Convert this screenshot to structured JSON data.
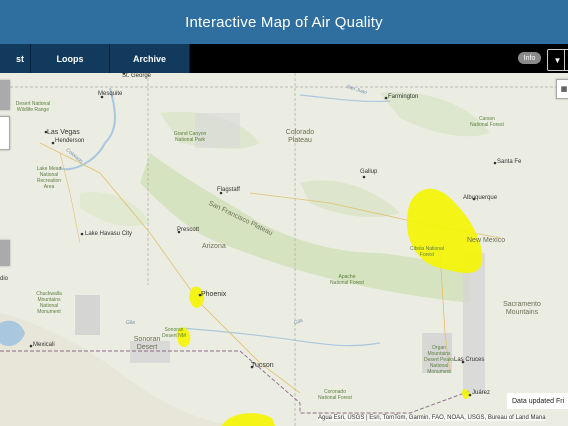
{
  "header": {
    "title": "Interactive Map of Air Quality"
  },
  "nav": {
    "tabs": [
      {
        "label": "st"
      },
      {
        "label": "Loops"
      },
      {
        "label": "Archive"
      }
    ]
  },
  "controls": {
    "info_label": "Info",
    "dropdown_icon": "caret-down-icon"
  },
  "map": {
    "cities": [
      "St. George",
      "Mesquite",
      "Las Vegas",
      "Henderson",
      "Lake Havasu City",
      "Flagstaff",
      "Prescott",
      "Phoenix",
      "Tucson",
      "Mexicali",
      "Farmington",
      "Gallup",
      "Albuquerque",
      "Santa Fe",
      "Las Cruces",
      "Juárez",
      "dio"
    ],
    "regions": [
      "Colorado Plateau",
      "San Francisco Plateau",
      "Arizona",
      "Sonoran Desert",
      "New Mexico",
      "Sacramento Mountains"
    ],
    "parks": [
      "Desert National Wildlife Range",
      "Grand Canyon National Park",
      "Lake Mead National Recreation Area",
      "Carson National Forest",
      "Cibola National Forest",
      "Apache National Forest",
      "Chuckwalla Mountains National Monument",
      "Sonoran Desert NM",
      "Organ Mountains Desert Peaks National Monument",
      "Coronado National Forest"
    ],
    "water": [
      "San Juan",
      "Gila",
      "Gila",
      "Colorado"
    ],
    "attribution": "Agua Esri, USGS | Esri, TomTom, Garmin, FAO, NOAA, USGS, Bureau of Land Mana",
    "status_text": "Data updated Fri",
    "highlight_color": "#f5f500"
  }
}
